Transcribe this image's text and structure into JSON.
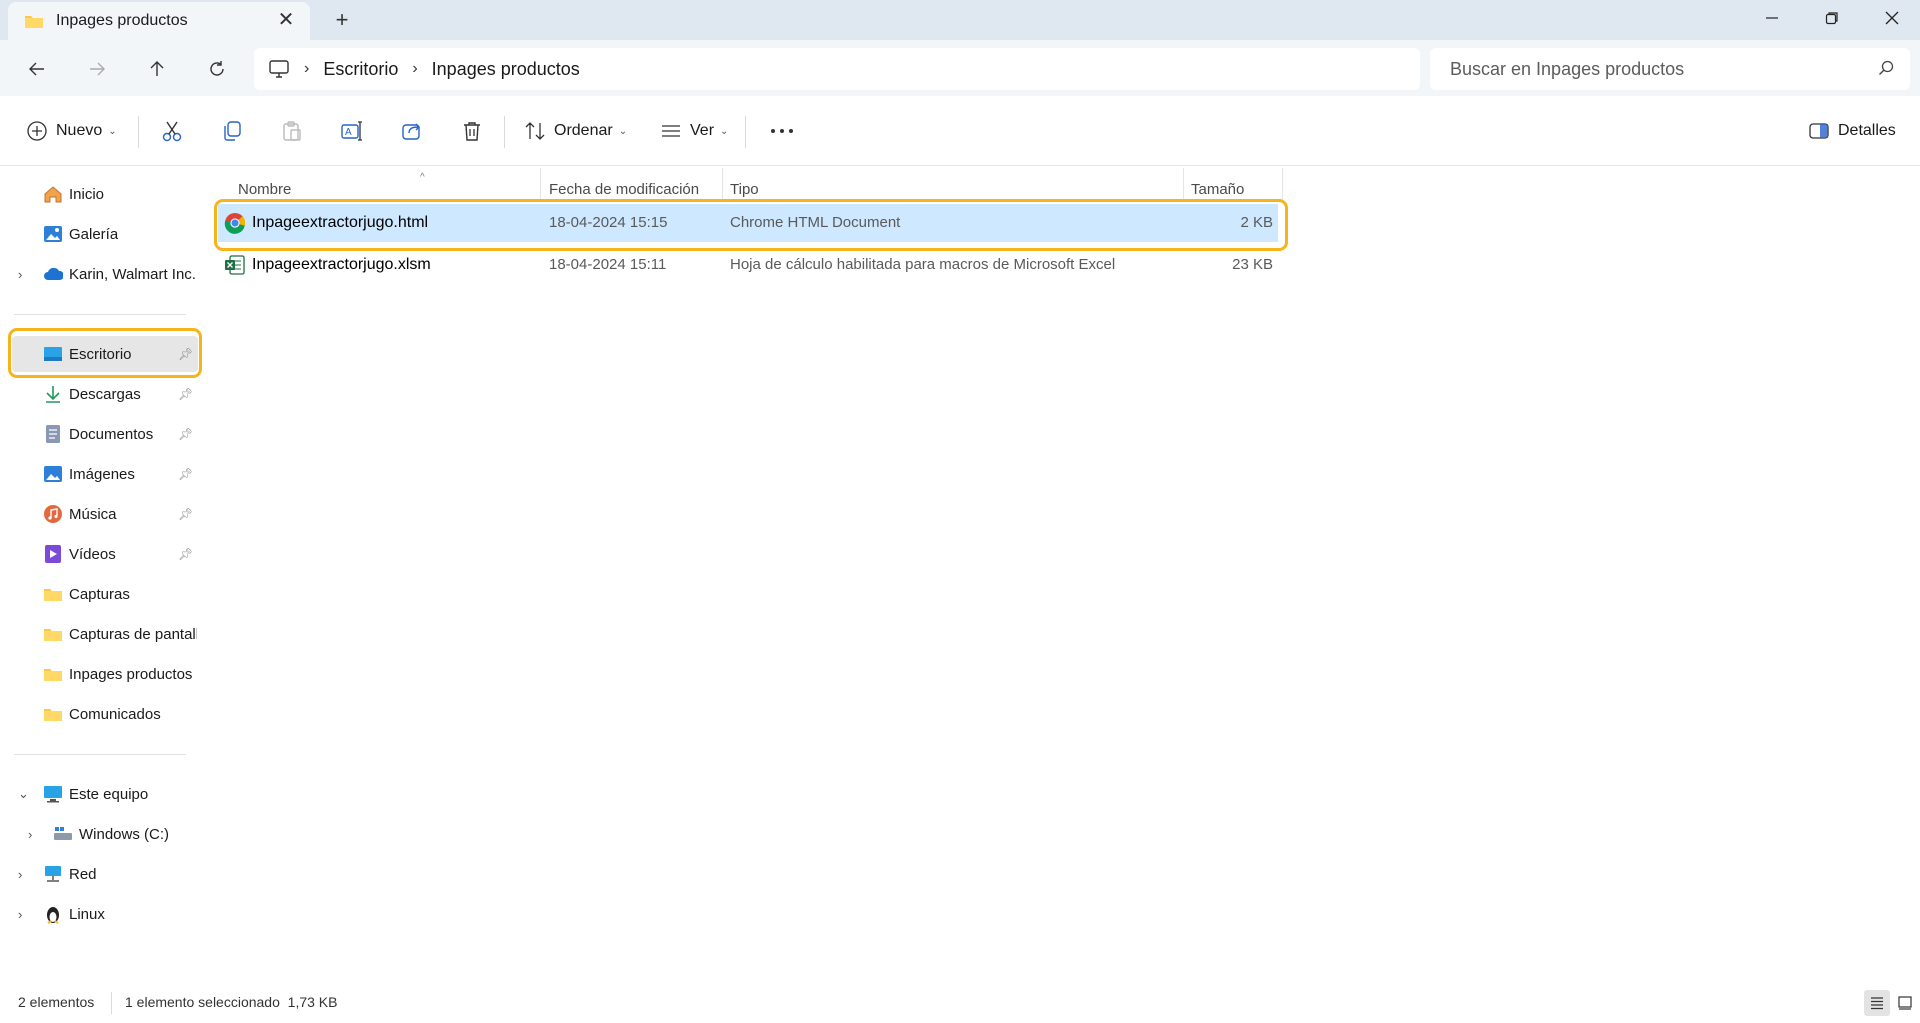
{
  "window": {
    "tab_title": "Inpages productos",
    "close_tab": "✕",
    "new_tab": "+"
  },
  "address": {
    "crumbs": [
      "Escritorio",
      "Inpages productos"
    ],
    "search_placeholder": "Buscar en Inpages productos"
  },
  "toolbar": {
    "new_label": "Nuevo",
    "sort_label": "Ordenar",
    "view_label": "Ver",
    "details_label": "Detalles"
  },
  "sidebar": {
    "top": [
      "Inicio",
      "Galería",
      "Karin, Walmart Inc."
    ],
    "quick": [
      {
        "label": "Escritorio",
        "pinned": true,
        "icon": "desktop-icon"
      },
      {
        "label": "Descargas",
        "pinned": true,
        "icon": "download-icon"
      },
      {
        "label": "Documentos",
        "pinned": true,
        "icon": "documents-icon"
      },
      {
        "label": "Imágenes",
        "pinned": true,
        "icon": "pictures-icon"
      },
      {
        "label": "Música",
        "pinned": true,
        "icon": "music-icon"
      },
      {
        "label": "Vídeos",
        "pinned": true,
        "icon": "videos-icon"
      },
      {
        "label": "Capturas",
        "pinned": false,
        "icon": "folder-icon"
      },
      {
        "label": "Capturas de pantalla",
        "pinned": false,
        "icon": "folder-icon"
      },
      {
        "label": "Inpages productos",
        "pinned": false,
        "icon": "folder-icon"
      },
      {
        "label": "Comunicados",
        "pinned": false,
        "icon": "folder-icon"
      }
    ],
    "devices": [
      "Este equipo",
      "Windows (C:)",
      "Red",
      "Linux"
    ]
  },
  "columns": {
    "name": "Nombre",
    "date": "Fecha de modificación",
    "type": "Tipo",
    "size": "Tamaño"
  },
  "files": [
    {
      "name": "Inpageextractorjugo.html",
      "date": "18-04-2024 15:15",
      "type": "Chrome HTML Document",
      "size": "2 KB",
      "icon": "chrome-icon",
      "selected": true
    },
    {
      "name": "Inpageextractorjugo.xlsm",
      "date": "18-04-2024 15:11",
      "type": "Hoja de cálculo habilitada para macros de Microsoft Excel",
      "size": "23 KB",
      "icon": "excel-icon",
      "selected": false
    }
  ],
  "status": {
    "count": "2 elementos",
    "selection": "1 elemento seleccionado  1,73 KB"
  },
  "colors": {
    "accent_highlight": "#f5b41a",
    "selection": "#cde8ff",
    "folder": "#f7c948"
  }
}
